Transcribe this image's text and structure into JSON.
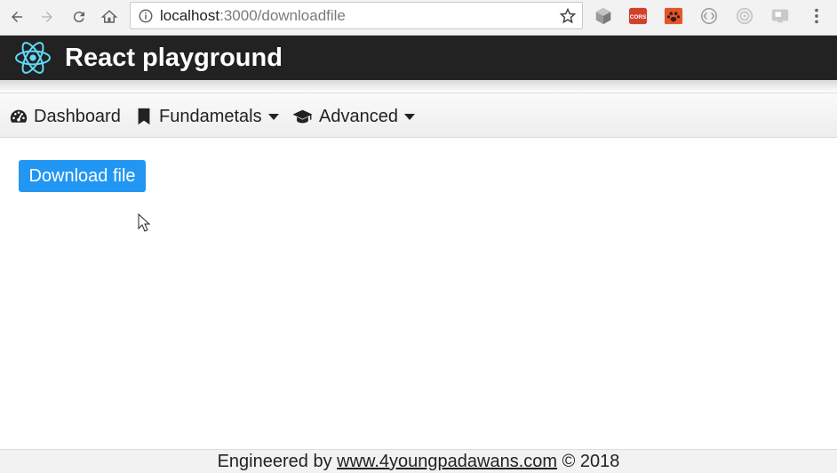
{
  "browser": {
    "url_host": "localhost",
    "url_path": ":3000/downloadfile",
    "icons": [
      "back-arrow-icon",
      "forward-arrow-icon",
      "reload-icon",
      "home-icon",
      "info-icon",
      "bookmark-star-icon"
    ],
    "extensions": [
      {
        "name": "cube-extension-icon"
      },
      {
        "name": "cors-extension-icon",
        "label": "CORS",
        "color": "#d0402b"
      },
      {
        "name": "paw-extension-icon",
        "color": "#e2562c"
      },
      {
        "name": "code-extension-icon"
      },
      {
        "name": "target-extension-icon"
      },
      {
        "name": "cast-extension-icon"
      },
      {
        "name": "menu-dots-icon"
      }
    ]
  },
  "header": {
    "title": "React playground",
    "background": "#222222",
    "logo": "react-logo-icon",
    "logo_color": "#61dafb"
  },
  "nav": {
    "items": [
      {
        "label": "Dashboard",
        "icon": "dashboard-gauge-icon"
      },
      {
        "label": "Fundametals",
        "icon": "bookmark-icon",
        "dropdown": true
      },
      {
        "label": "Advanced",
        "icon": "graduation-cap-icon",
        "dropdown": true
      }
    ]
  },
  "main": {
    "download_button": "Download file",
    "button_color": "#2196f3"
  },
  "footer": {
    "prefix": "Engineered by ",
    "link_text": "www.4youngpadawans.com",
    "suffix": " © 2018"
  }
}
